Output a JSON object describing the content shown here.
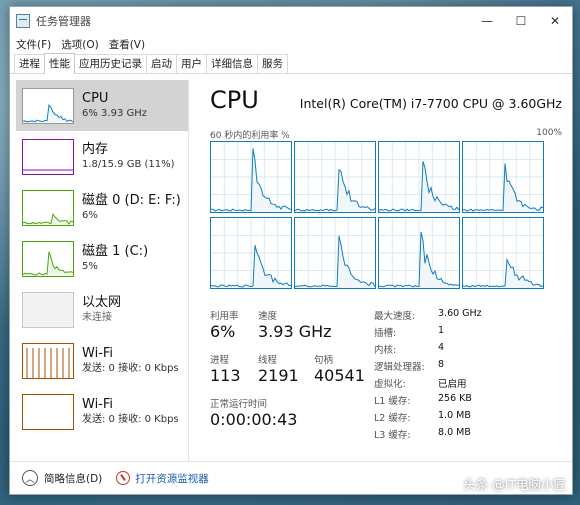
{
  "window": {
    "title": "任务管理器",
    "controls": [
      "—",
      "☐",
      "✕"
    ]
  },
  "menu": [
    "文件(F)",
    "选项(O)",
    "查看(V)"
  ],
  "tabs": [
    {
      "label": "进程",
      "active": false
    },
    {
      "label": "性能",
      "active": true
    },
    {
      "label": "应用历史记录",
      "active": false
    },
    {
      "label": "启动",
      "active": false
    },
    {
      "label": "用户",
      "active": false
    },
    {
      "label": "详细信息",
      "active": false
    },
    {
      "label": "服务",
      "active": false
    }
  ],
  "sidebar": {
    "items": [
      {
        "name": "CPU",
        "sub": "6% 3.93 GHz",
        "color": "#117dbb",
        "active": true
      },
      {
        "name": "内存",
        "sub": "1.8/15.9 GB (11%)",
        "color": "#8b12ae",
        "active": false
      },
      {
        "name": "磁盘 0 (D: E: F:)",
        "sub": "6%",
        "color": "#4da60c",
        "active": false
      },
      {
        "name": "磁盘 1 (C:)",
        "sub": "5%",
        "color": "#4da60c",
        "active": false
      },
      {
        "name": "以太网",
        "sub": "未连接",
        "color": "#a7a7a7",
        "active": false
      },
      {
        "name": "Wi-Fi",
        "sub": "发送: 0 接收: 0 Kbps",
        "color": "#a74f01",
        "active": false
      },
      {
        "name": "Wi-Fi",
        "sub": "发送: 0 接收: 0 Kbps",
        "color": "#a74f01",
        "active": false
      }
    ]
  },
  "main": {
    "title": "CPU",
    "model": "Intel(R) Core(TM) i7-7700 CPU @ 3.60GHz",
    "util_label": "60 秒内的利用率 %",
    "util_max": "100%",
    "core_count": 8,
    "stats": {
      "util_label": "利用率",
      "util_value": "6%",
      "speed_label": "速度",
      "speed_value": "3.93 GHz",
      "proc_label": "进程",
      "proc_value": "113",
      "thread_label": "线程",
      "thread_value": "2191",
      "handle_label": "句柄",
      "handle_value": "40541",
      "uptime_label": "正常运行时间",
      "uptime_value": "0:00:00:43"
    },
    "specs": [
      {
        "key": "最大速度:",
        "value": "3.60 GHz"
      },
      {
        "key": "插槽:",
        "value": "1"
      },
      {
        "key": "内核:",
        "value": "4"
      },
      {
        "key": "逻辑处理器:",
        "value": "8"
      },
      {
        "key": "虚拟化:",
        "value": "已启用"
      },
      {
        "key": "L1 缓存:",
        "value": "256 KB"
      },
      {
        "key": "L2 缓存:",
        "value": "1.0 MB"
      },
      {
        "key": "L3 缓存:",
        "value": "8.0 MB"
      }
    ]
  },
  "footer": {
    "summary": "简略信息(D)",
    "resmon": "打开资源监视器"
  },
  "watermark": "头条 @IT电脑小匠",
  "colors": {
    "cpu": "#117dbb",
    "cpu_fill": "#f1f6fa",
    "selected_bg": "#d3d3d3"
  }
}
